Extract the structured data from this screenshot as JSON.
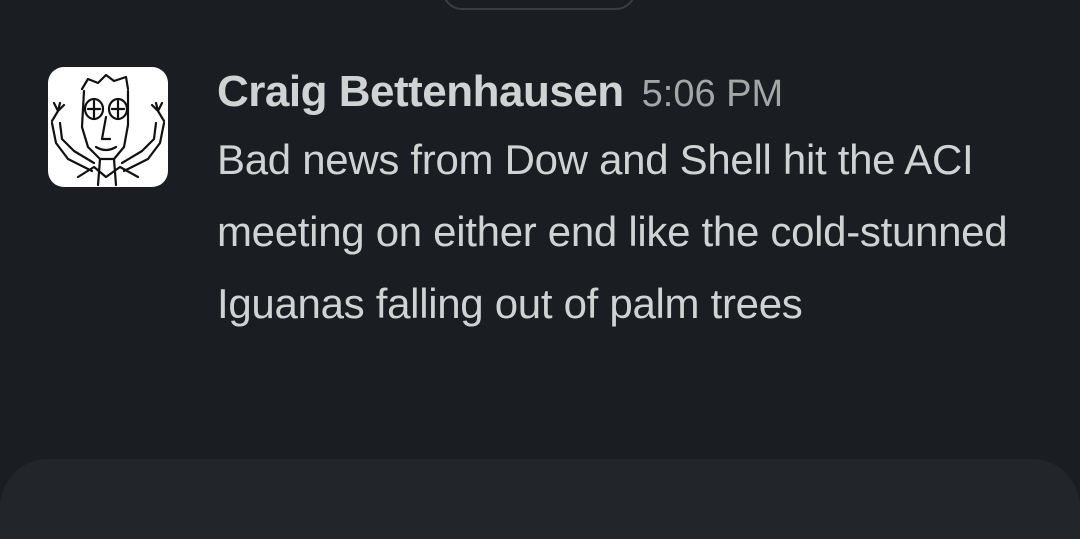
{
  "message": {
    "sender": "Craig Bettenhausen",
    "time": "5:06 PM",
    "text": "Bad news from Dow and Shell hit the ACI meeting on either end like the cold-stunned Iguanas falling out of palm trees",
    "avatar_icon": "cartoon-face-avatar-icon"
  },
  "colors": {
    "background": "#1a1d21",
    "composer": "#222529",
    "text": "#d1d2d3",
    "timestamp": "#a5a6a8"
  }
}
